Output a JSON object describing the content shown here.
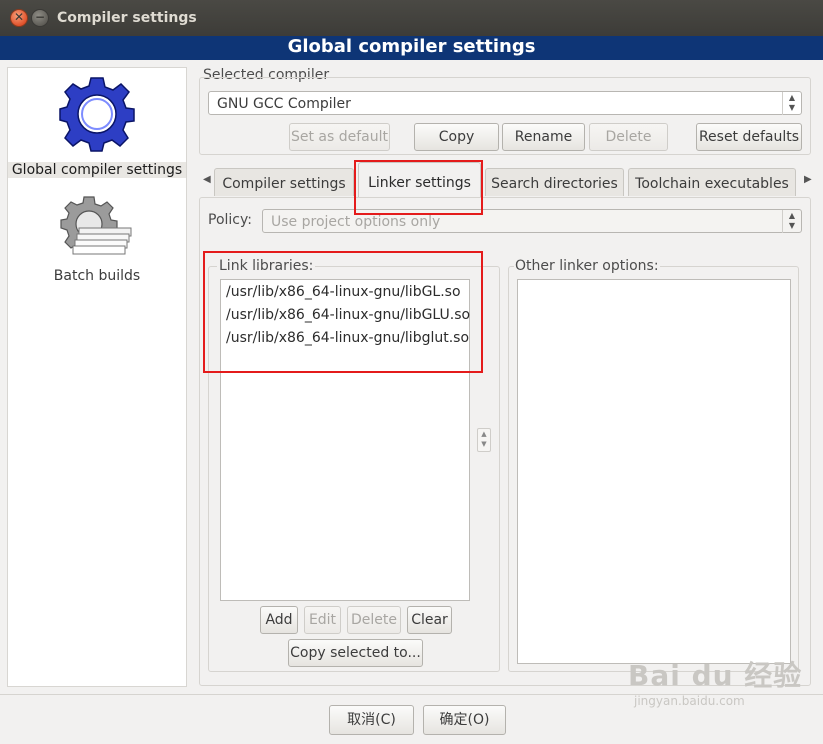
{
  "window": {
    "title": "Compiler settings",
    "close_glyph": "✕",
    "minimize_glyph": "−"
  },
  "header": {
    "title": "Global compiler settings"
  },
  "sidebar": {
    "items": [
      {
        "label": "Global compiler settings",
        "icon": "gear-icon",
        "selected": true
      },
      {
        "label": "Batch builds",
        "icon": "batch-gear-icon",
        "selected": false
      }
    ]
  },
  "compiler": {
    "group_label": "Selected compiler",
    "selected": "GNU GCC Compiler",
    "buttons": {
      "set_default": "Set as default",
      "copy": "Copy",
      "rename": "Rename",
      "delete": "Delete",
      "reset_defaults": "Reset defaults"
    }
  },
  "tabs": {
    "scroll_left": "◀",
    "scroll_right": "▶",
    "items": [
      {
        "label": "Compiler settings"
      },
      {
        "label": "Linker settings",
        "active": true
      },
      {
        "label": "Search directories"
      },
      {
        "label": "Toolchain executables"
      }
    ]
  },
  "linker": {
    "policy_label": "Policy:",
    "policy_value": "Use project options only",
    "link_libraries_label": "Link libraries:",
    "libraries": [
      "/usr/lib/x86_64-linux-gnu/libGL.so",
      "/usr/lib/x86_64-linux-gnu/libGLU.so",
      "/usr/lib/x86_64-linux-gnu/libglut.so"
    ],
    "other_options_label": "Other linker options:",
    "buttons": {
      "add": "Add",
      "edit": "Edit",
      "delete": "Delete",
      "clear": "Clear",
      "copy_selected": "Copy selected to..."
    }
  },
  "footer": {
    "cancel": "取消(C)",
    "ok": "确定(O)"
  },
  "watermark": {
    "brand": "Bai du 经验",
    "url": "jingyan.baidu.com"
  },
  "colors": {
    "header_bg": "#0e3576",
    "highlight_box": "#e41b1b"
  }
}
